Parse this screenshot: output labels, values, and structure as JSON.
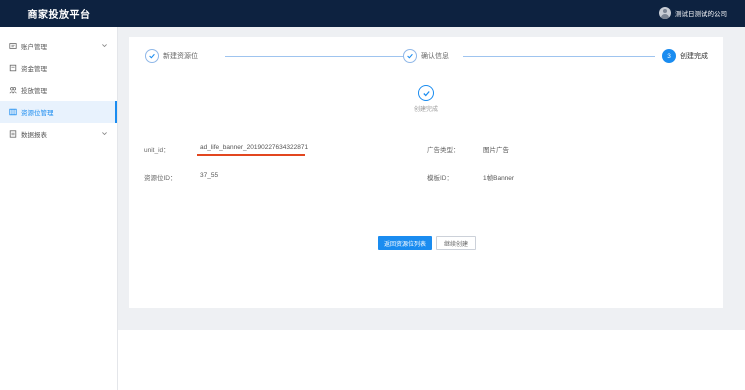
{
  "app": {
    "brand": "商家投放平台",
    "user_name": "测试日测试的公司"
  },
  "sidebar": {
    "items": [
      {
        "label": "账户管理",
        "icon": "user-card-icon",
        "expandable": true
      },
      {
        "label": "资金管理",
        "icon": "wallet-icon",
        "expandable": false
      },
      {
        "label": "投放管理",
        "icon": "people-icon",
        "expandable": false
      },
      {
        "label": "资源位管理",
        "icon": "grid-icon",
        "expandable": false,
        "active": true
      },
      {
        "label": "数据报表",
        "icon": "report-icon",
        "expandable": true
      }
    ]
  },
  "steps": [
    {
      "label": "新建资源位",
      "state": "done"
    },
    {
      "label": "确认信息",
      "state": "done"
    },
    {
      "label": "创建完成",
      "state": "current",
      "number": "3"
    }
  ],
  "result": {
    "status_text": "创建完成"
  },
  "details": {
    "unit_id_label": "unit_id：",
    "unit_id_value": "ad_life_banner_20190227634322871",
    "ad_type_label": "广告类型：",
    "ad_type_value": "图片广告",
    "slot_id_label": "资源位ID：",
    "slot_id_value": "37_55",
    "template_id_label": "模板ID：",
    "template_id_value": "1帧Banner"
  },
  "actions": {
    "back_label": "返回资源位列表",
    "continue_label": "继续创建"
  },
  "colors": {
    "topbar": "#0d2240",
    "accent": "#1a8cf0",
    "highlight": "#e2461f"
  }
}
